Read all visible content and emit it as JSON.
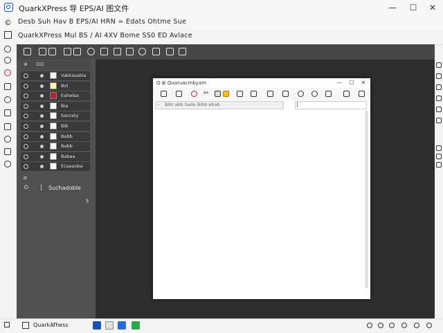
{
  "window": {
    "title": "QuarkXPress 导 EPS/AI 图文件",
    "minimize_glyph": "—",
    "maximize_glyph": "☐",
    "close_glyph": "✕"
  },
  "menubar": {
    "text": "Desb Suh Hav B EPS/AI HRN = Edats Ohtme Sue"
  },
  "toolbar": {
    "text": "QuarkXPress Mul BS / AI 4XV Bome SS0 ED Avlace"
  },
  "layers": {
    "rows": [
      {
        "name": "Vakkasabla",
        "swatch": "#f2f2f2"
      },
      {
        "name": "Bol",
        "swatch": "#fff4a0"
      },
      {
        "name": "Eahelaa",
        "swatch": "#c0202a"
      },
      {
        "name": "Bia",
        "swatch": "#ffffff"
      },
      {
        "name": "Sanraty",
        "swatch": "#ffffff"
      },
      {
        "name": "Bib",
        "swatch": "#ffffff"
      },
      {
        "name": "Babb",
        "swatch": "#ffffff"
      },
      {
        "name": "Babb",
        "swatch": "#ffffff"
      },
      {
        "name": "Babaa",
        "swatch": "#ffffff"
      },
      {
        "name": "Ecaaaoba",
        "swatch": "#ffffff"
      }
    ],
    "footer_label": "Suchadoble"
  },
  "dialog": {
    "title": "Quaruacmbyam",
    "path": "Bibl abb Sada Bibb ebab",
    "search_value": "|",
    "minimize_glyph": "—",
    "maximize_glyph": "☐",
    "close_glyph": "✕"
  },
  "taskbar": {
    "app_label": "QuarkAfhess"
  },
  "colors": {
    "workspace": "#3a3a3a",
    "panel": "#505050",
    "accent": "#1a4fb5"
  }
}
